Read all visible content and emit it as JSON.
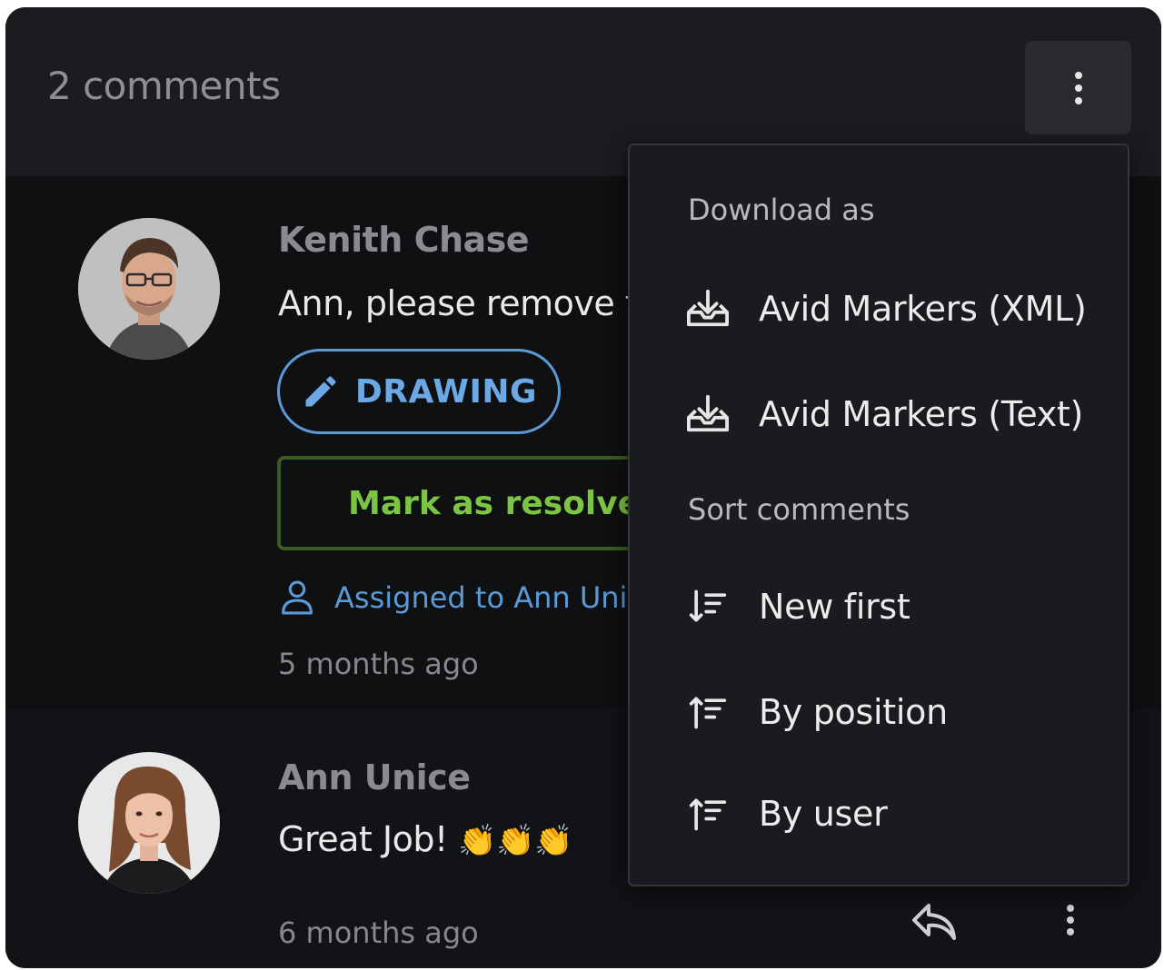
{
  "header": {
    "comment_count": "2 comments",
    "menu_icon": "kebab-vertical-icon"
  },
  "comments": [
    {
      "author": "Kenith Chase",
      "text": "Ann, please remove th",
      "drawing_label": "DRAWING",
      "resolve_label": "Mark as resolved",
      "assigned_label": "Assigned to Ann Unice",
      "timestamp": "5 months ago"
    },
    {
      "author": "Ann Unice",
      "text": "Great Job!",
      "emoji": "👏👏👏",
      "timestamp": "6 months ago"
    }
  ],
  "dropdown": {
    "download_title": "Download as",
    "download_items": [
      {
        "label": "Avid Markers (XML)",
        "icon": "download-tray-icon"
      },
      {
        "label": "Avid Markers (Text)",
        "icon": "download-tray-icon"
      }
    ],
    "sort_title": "Sort comments",
    "sort_items": [
      {
        "label": "New first",
        "icon": "sort-descending-icon"
      },
      {
        "label": "By position",
        "icon": "sort-ascending-icon"
      },
      {
        "label": "By user",
        "icon": "sort-ascending-icon"
      }
    ]
  },
  "colors": {
    "background": "#0f1012",
    "accent_blue": "#5b9ad6",
    "accent_green": "#7cc443"
  }
}
